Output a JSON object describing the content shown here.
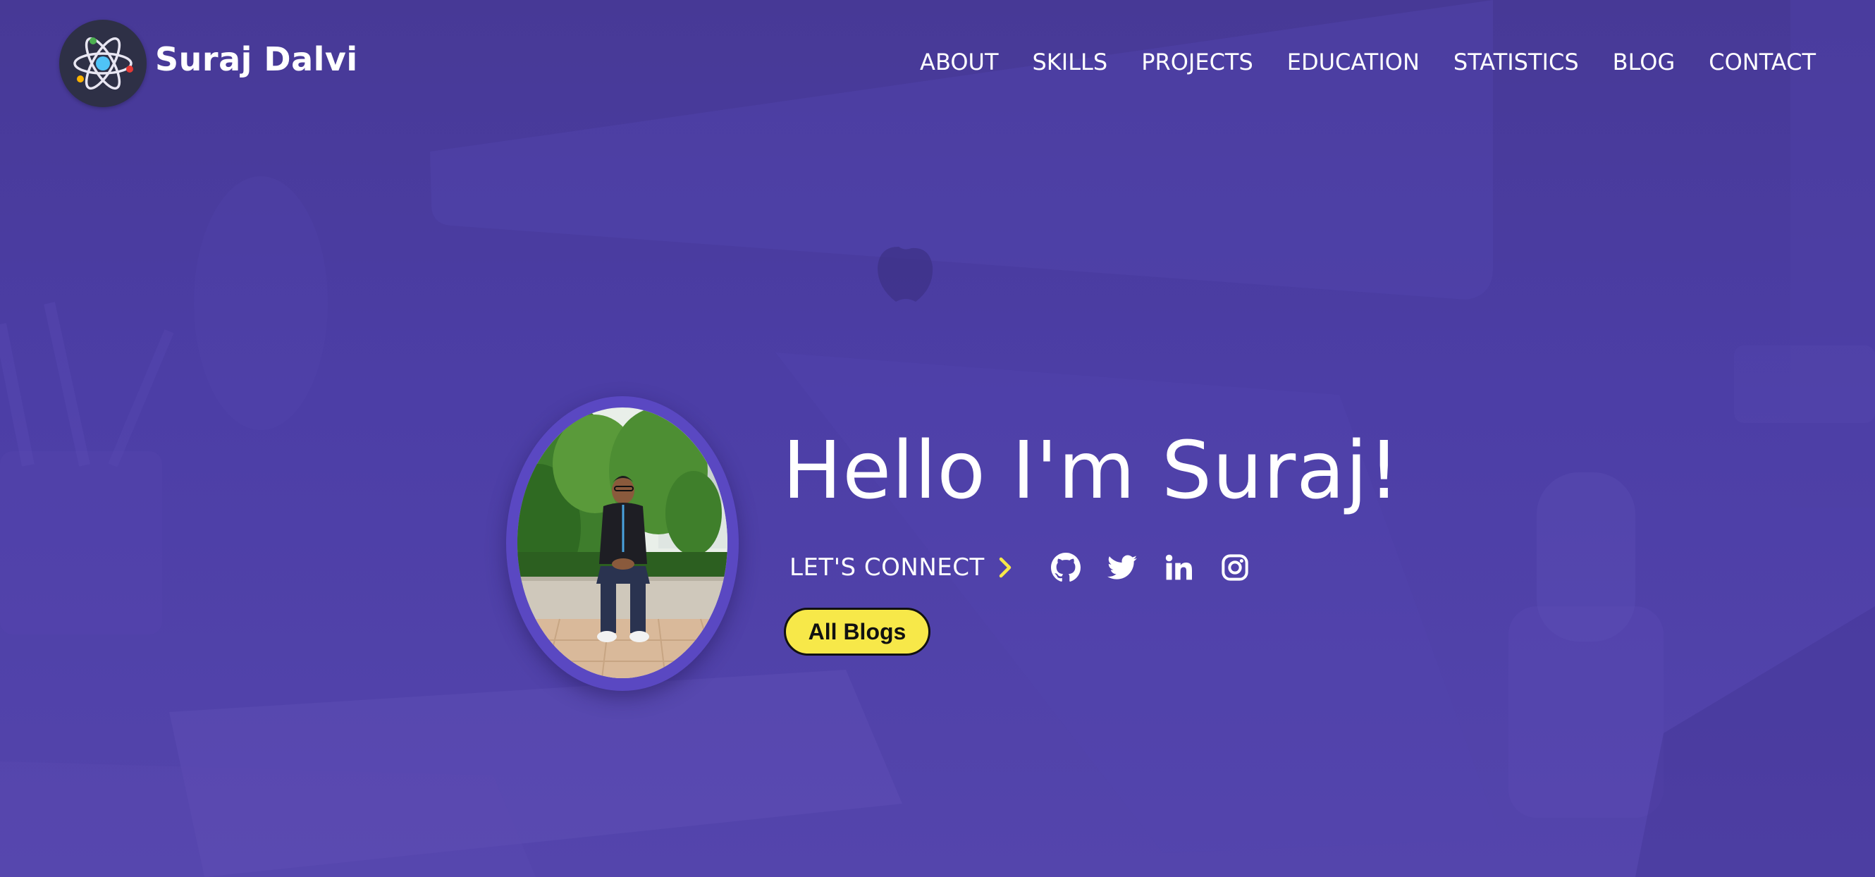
{
  "brand": {
    "name": "Suraj Dalvi",
    "logo_icon": "atom-icon"
  },
  "nav": {
    "items": [
      {
        "label": "ABOUT"
      },
      {
        "label": "SKILLS"
      },
      {
        "label": "PROJECTS"
      },
      {
        "label": "EDUCATION"
      },
      {
        "label": "STATISTICS"
      },
      {
        "label": "BLOG"
      },
      {
        "label": "CONTACT"
      }
    ]
  },
  "hero": {
    "title": "Hello I'm Suraj!",
    "connect_label": "LET'S CONNECT",
    "connect_icon": "chevron-right-icon",
    "socials": [
      {
        "icon": "github-icon"
      },
      {
        "icon": "twitter-icon"
      },
      {
        "icon": "linkedin-icon"
      },
      {
        "icon": "instagram-icon"
      }
    ],
    "cta_label": "All Blogs"
  },
  "colors": {
    "background": "#4a3ca0",
    "accent_yellow": "#f7e849",
    "avatar_ring": "#5a48c2",
    "text": "#ffffff"
  }
}
